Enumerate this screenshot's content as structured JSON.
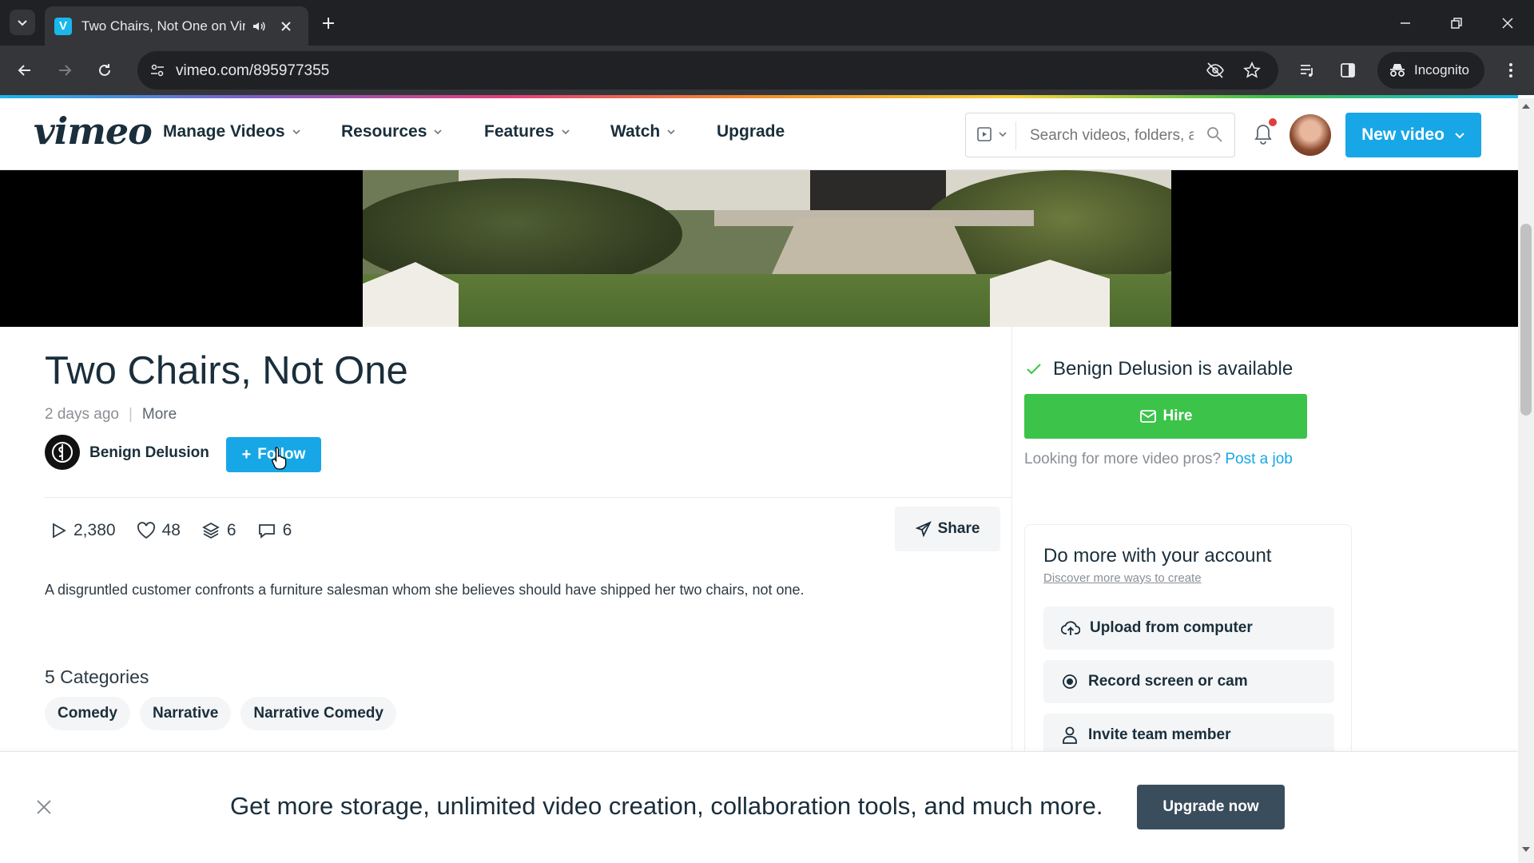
{
  "browser": {
    "tab_title": "Two Chairs, Not One on Vimeo",
    "tab_favicon": "V",
    "url": "vimeo.com/895977355",
    "incognito_label": "Incognito"
  },
  "site": {
    "logo": "vimeo",
    "nav": [
      "Manage Videos",
      "Resources",
      "Features",
      "Watch",
      "Upgrade"
    ],
    "search_placeholder": "Search videos, folders, and more",
    "new_video_label": "New video",
    "accent_color": "#17a7e6"
  },
  "video": {
    "title": "Two Chairs, Not One",
    "posted": "2 days ago",
    "more_label": "More",
    "author": "Benign Delusion",
    "follow_label": "Follow",
    "stats": {
      "plays": "2,380",
      "likes": "48",
      "collections": "6",
      "comments": "6"
    },
    "share_label": "Share",
    "description": "A disgruntled customer confronts a furniture salesman whom she believes should have shipped her two chairs, not one.",
    "categories_title": "5 Categories",
    "categories": [
      "Comedy",
      "Narrative",
      "Narrative Comedy"
    ]
  },
  "sidebar": {
    "availability": "Benign Delusion is available",
    "hire_label": "Hire",
    "pros_text": "Looking for more video pros?",
    "post_job_label": "Post a job",
    "do_more_title": "Do more with your account",
    "do_more_link": "Discover more ways to create",
    "actions": [
      "Upload from computer",
      "Record screen or cam",
      "Invite team member"
    ],
    "hire_color": "#3bc34a"
  },
  "banner": {
    "text": "Get more storage, unlimited video creation, collaboration tools, and much more.",
    "upgrade_label": "Upgrade now"
  }
}
